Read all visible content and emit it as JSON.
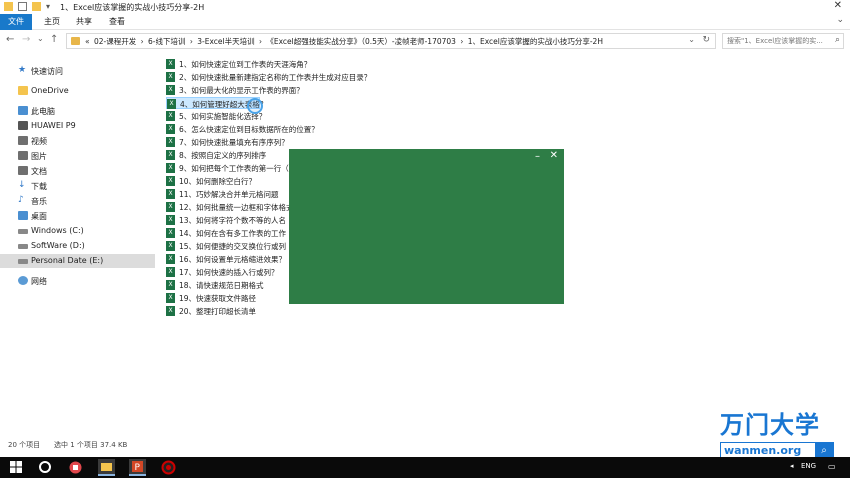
{
  "window": {
    "title": "1、Excel应该掌握的实战小技巧分享-2H"
  },
  "ribbon": {
    "tabs": [
      "文件",
      "主页",
      "共享",
      "查看"
    ]
  },
  "address": {
    "path": "« 02-课程开发 › 6-线下培训 › 3-Excel半天培训 › 《Excel超强技能实战分享》（0.5天）-凌帧老师-170703 › 1、Excel应该掌握的实战小技巧分享-2H",
    "search_placeholder": "搜索\"1、Excel应该掌握的实..."
  },
  "nav": {
    "items": [
      {
        "label": "快速访问",
        "icon": "pin-icon"
      },
      {
        "label": "OneDrive",
        "icon": "folder-icon"
      },
      {
        "label": "此电脑",
        "icon": "pc-icon"
      },
      {
        "label": "HUAWEI P9",
        "icon": "phone-icon"
      },
      {
        "label": "视频",
        "icon": "video-icon"
      },
      {
        "label": "图片",
        "icon": "picture-icon"
      },
      {
        "label": "文档",
        "icon": "document-icon"
      },
      {
        "label": "下载",
        "icon": "download-icon"
      },
      {
        "label": "音乐",
        "icon": "music-icon"
      },
      {
        "label": "桌面",
        "icon": "desktop-icon"
      },
      {
        "label": "Windows (C:)",
        "icon": "drive-icon"
      },
      {
        "label": "SoftWare (D:)",
        "icon": "drive-icon"
      },
      {
        "label": "Personal Date (E:)",
        "icon": "drive-icon"
      },
      {
        "label": "网络",
        "icon": "network-icon"
      }
    ],
    "selected": "Personal Date (E:)"
  },
  "files": [
    "1、如何快速定位到工作表的天涯海角？",
    "2、如何快速批量新建指定名称的工作表并生成对应目录？",
    "3、如何最大化的显示工作表的界面？",
    "4、如何管理好超大表格？",
    "5、如何实施智能化选择？",
    "6、怎么快速定位到目标数据所在的位置？",
    "7、如何快速批量填充有序序列？",
    "8、按照自定义的序列排序",
    "9、如何把每个工作表的第一行（",
    "10、如何删除空白行？",
    "11、巧妙解决合并单元格问题",
    "12、如何批量统一边框和字体格式",
    "13、如何将字符个数不等的人名",
    "14、如何在含有多工作表的工作",
    "15、如何便捷的交叉换位行或列",
    "16、如何设置单元格缩进效果？",
    "17、如何快速的插入行或列？",
    "18、请快速规范日期格式",
    "19、快速获取文件路径",
    "20、整理打印超长清单"
  ],
  "selected_file_index": 3,
  "overlay": {
    "color": "#2e7d46",
    "minimize": "–",
    "close": "✕"
  },
  "status": {
    "count": "20 个项目",
    "selection": "选中 1 个项目  37.4 KB"
  },
  "watermark": {
    "brand": "万门大学",
    "url": "wanmen.org"
  },
  "tray": {
    "lang": "ENG"
  }
}
